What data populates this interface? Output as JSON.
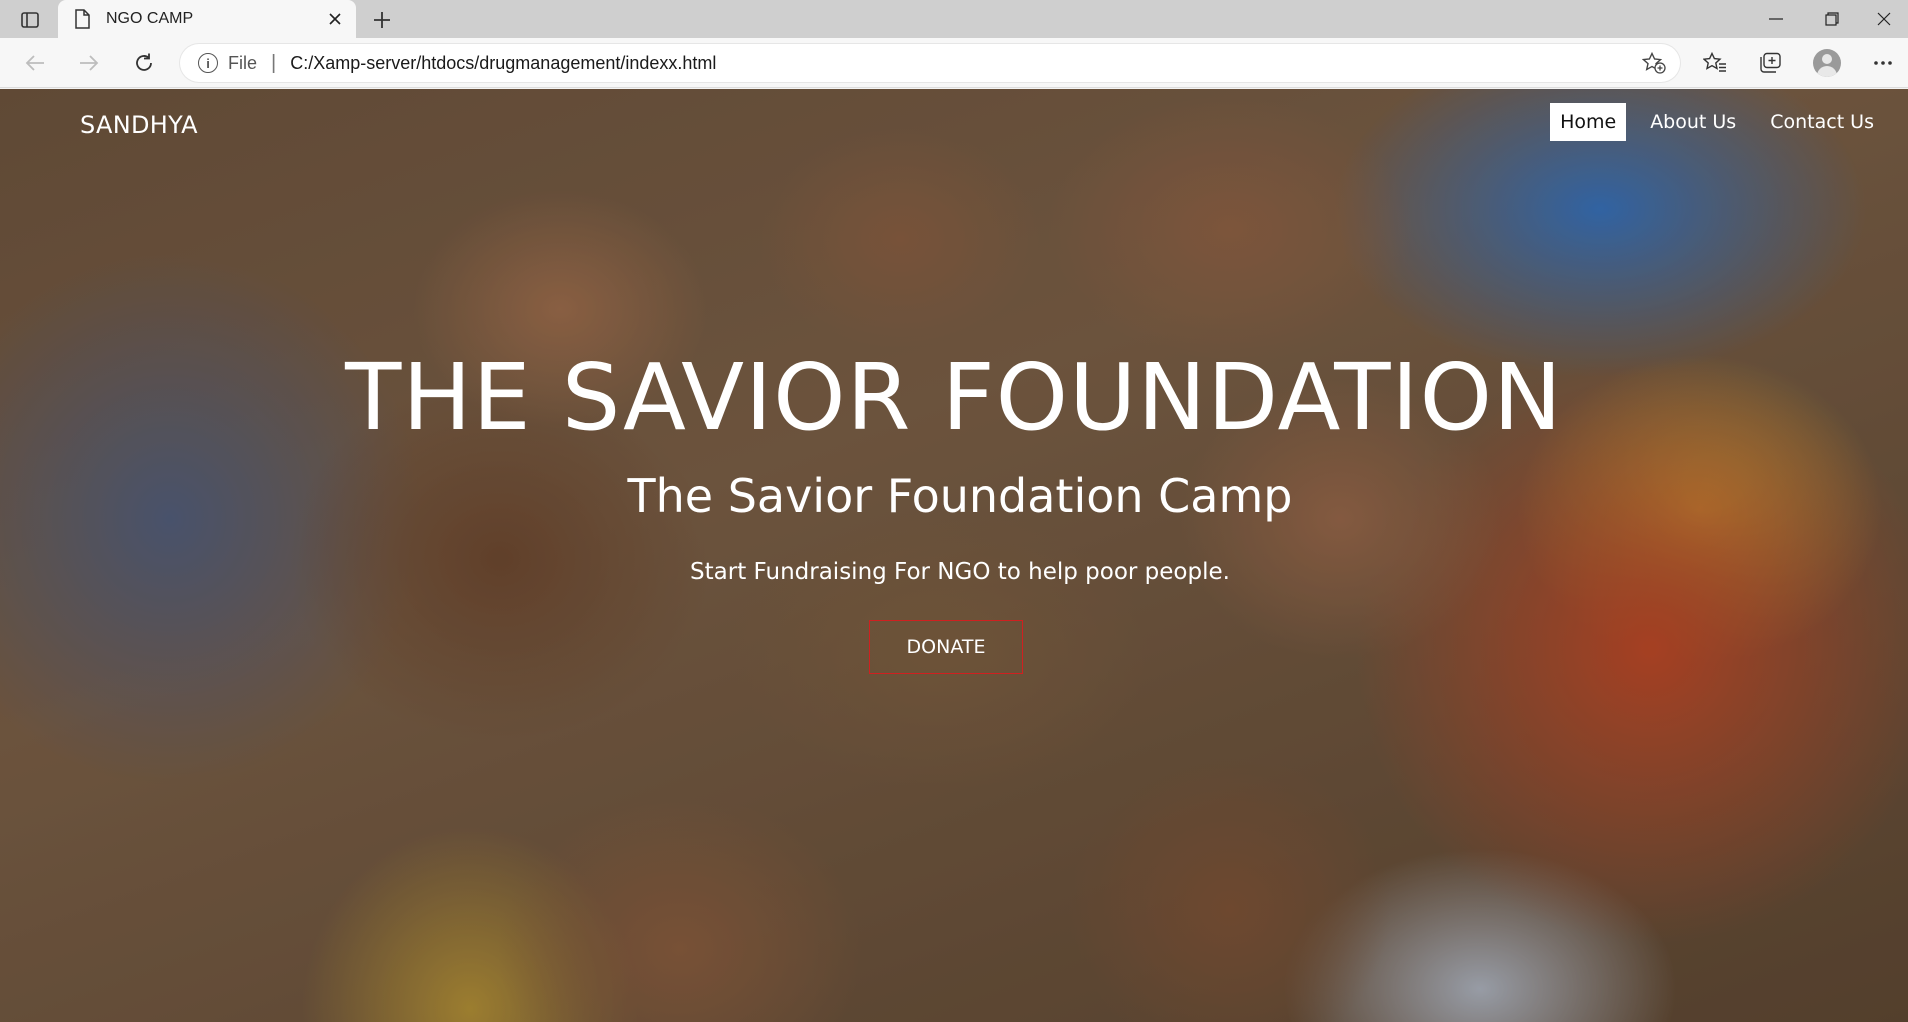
{
  "browser": {
    "tab_title": "NGO CAMP",
    "address_scheme": "File",
    "address_url": "C:/Xamp-server/htdocs/drugmanagement/indexx.html",
    "icons": [
      "tab-actions-icon",
      "document-icon",
      "close-icon",
      "new-tab-icon",
      "minimize-icon",
      "restore-icon",
      "window-close-icon",
      "back-icon",
      "forward-icon",
      "refresh-icon",
      "info-icon",
      "add-favorite-icon",
      "favorites-icon",
      "collections-icon",
      "profile-icon",
      "more-icon"
    ]
  },
  "page": {
    "brand": "SANDHYA",
    "nav": [
      {
        "label": "Home",
        "active": true
      },
      {
        "label": "About Us",
        "active": false
      },
      {
        "label": "Contact Us",
        "active": false
      }
    ],
    "headline": "THE SAVIOR FOUNDATION",
    "subheadline": "The Savior Foundation Camp",
    "tagline": "Start Fundraising For NGO to help poor people.",
    "donate_label": "DONATE",
    "colors": {
      "donate_border": "#d02020",
      "text": "#ffffff",
      "active_nav_bg": "#ffffff"
    }
  }
}
